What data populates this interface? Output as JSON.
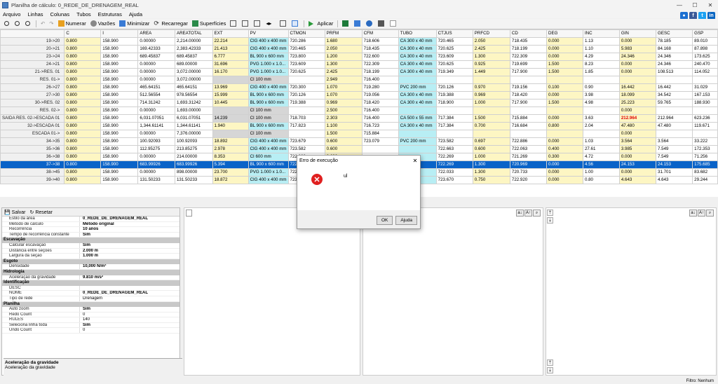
{
  "window": {
    "title": "Planilha de cálculo: 0_REDE_DE_DRENAGEM_REAL",
    "min": "—",
    "max": "☐",
    "close": "✕"
  },
  "menu": [
    "Arquivo",
    "Linhas",
    "Colunas",
    "Tubos",
    "Estruturas",
    "Ajuda"
  ],
  "toolbar": {
    "numerar": "Numerar",
    "vazoes": "Vazões",
    "minimizar": "Minimizar",
    "recarregar": "Recarregar",
    "superficies": "Superfícies",
    "aplicar": "Aplicar"
  },
  "columns": [
    "C",
    "I",
    "AREA",
    "AREATOTAL",
    "EXT",
    "PV",
    "CTMON",
    "PRFM",
    "CFM",
    "TUBO",
    "CTJUS",
    "PRFCD",
    "CD",
    "DEG",
    "INC",
    "GIN",
    "GESC",
    "GSP"
  ],
  "rows": [
    [
      "19->20",
      "0.800",
      "158.900",
      "0.00000",
      "2,214.00000",
      "22.214",
      "CIG 400 x 400 mm",
      "720.286",
      "1.680",
      "718.606",
      "CA 300 x 40 mm",
      "720.465",
      "2.050",
      "718.435",
      "0.000",
      "1.13",
      "0.000",
      "78.185",
      "89.010"
    ],
    [
      "20->21",
      "0.800",
      "158.900",
      "169.42333",
      "2,383.42333",
      "21.413",
      "CIG 400 x 400 mm",
      "720.465",
      "2.050",
      "718.435",
      "CA 300 x 40 mm",
      "720.625",
      "2.425",
      "718.199",
      "0.000",
      "1.10",
      "5.983",
      "84.168",
      "87.898"
    ],
    [
      "23->24",
      "0.800",
      "158.900",
      "689.45837",
      "689.45837",
      "6.777",
      "BL 900 x 600 mm",
      "723.800",
      "1.200",
      "722.600",
      "CA 300 x 40 mm",
      "723.609",
      "1.300",
      "722.309",
      "0.000",
      "4.29",
      "24.346",
      "24.346",
      "173.625"
    ],
    [
      "24->21",
      "0.800",
      "158.900",
      "0.00000",
      "689.00000",
      "31.696",
      "PVG 1.000 x 1.0...",
      "723.609",
      "1.300",
      "722.309",
      "CA 300 x 40 mm",
      "720.625",
      "0.925",
      "719.699",
      "1.500",
      "8.23",
      "0.000",
      "24.346",
      "240.470"
    ],
    [
      "21->RES. 01",
      "0.800",
      "158.900",
      "0.00000",
      "3,072.00000",
      "16.170",
      "PVG 1.000 x 1.0...",
      "720.625",
      "2.425",
      "718.199",
      "CA 300 x 40 mm",
      "719.349",
      "1.449",
      "717.900",
      "1.500",
      "1.85",
      "0.000",
      "108.513",
      "114.052"
    ],
    [
      "RES. 01->",
      "0.800",
      "158.900",
      "0.00000",
      "3,072.00000",
      "",
      "CI 100 mm",
      "",
      "2.949",
      "716.400",
      "",
      "",
      "",
      "",
      "",
      "",
      "",
      "",
      ""
    ],
    [
      "26->27",
      "0.800",
      "158.900",
      "465.64151",
      "465.64151",
      "13.969",
      "CIG 400 x 400 mm",
      "720.300",
      "1.070",
      "719.280",
      "PVC 200 mm",
      "720.126",
      "0.970",
      "719.156",
      "0.100",
      "0.90",
      "16.442",
      "16.442",
      "31.029"
    ],
    [
      "27->30",
      "0.800",
      "158.900",
      "512.56554",
      "978.56554",
      "15.999",
      "BL 900 x 600 mm",
      "720.126",
      "1.070",
      "719.056",
      "CA 300 x 40 mm",
      "719.388",
      "0.969",
      "718.420",
      "0.000",
      "3.98",
      "18.099",
      "34.542",
      "167.153"
    ],
    [
      "30->RES. 02",
      "0.800",
      "158.900",
      "714.31242",
      "1,693.31242",
      "10.445",
      "BL 900 x 600 mm",
      "719.388",
      "0.969",
      "718.420",
      "CA 300 x 40 mm",
      "718.900",
      "1.000",
      "717.900",
      "1.500",
      "4.98",
      "25.223",
      "59.765",
      "188.930"
    ],
    [
      "RES. 02->",
      "0.800",
      "158.900",
      "0.00000",
      "1,693.00000",
      "",
      "CI 100 mm",
      "",
      "2.500",
      "716.400",
      "",
      "",
      "",
      "",
      "",
      "",
      "0.000",
      "",
      ""
    ],
    [
      "SAIDA RES. 02->ESCADA 01",
      "0.800",
      "158.900",
      "6,031.07051",
      "6,031.07051",
      "14.239",
      "CI 100 mm",
      "718.703",
      "2.303",
      "716.400",
      "CA 500 x 55 mm",
      "717.384",
      "1.500",
      "715.884",
      "0.000",
      "3.63",
      "212.964",
      "212.964",
      "623.236"
    ],
    [
      "32->ESCADA 01",
      "0.800",
      "158.900",
      "1,344.61141",
      "1,344.61141",
      "1.940",
      "BL 900 x 600 mm",
      "717.823",
      "1.100",
      "716.723",
      "CA 300 x 40 mm",
      "717.384",
      "0.700",
      "716.684",
      "0.800",
      "2.04",
      "47.480",
      "47.480",
      "119.671"
    ],
    [
      "ESCADA 01->",
      "0.800",
      "158.900",
      "0.00000",
      "7,376.00000",
      "",
      "CI 100 mm",
      "",
      "1.500",
      "715.884",
      "",
      "",
      "",
      "",
      "",
      "",
      "0.000",
      "",
      ""
    ],
    [
      "34->35",
      "0.800",
      "158.900",
      "100.92093",
      "100.92093",
      "18.892",
      "CIG 400 x 400 mm",
      "723.679",
      "0.600",
      "723.079",
      "PVC 200 mm",
      "723.582",
      "0.697",
      "722.886",
      "0.000",
      "1.03",
      "3.564",
      "3.564",
      "33.222"
    ],
    [
      "35->36",
      "0.800",
      "158.900",
      "112.95275",
      "213.85275",
      "2.978",
      "CIG 400 x 400 mm",
      "723.582",
      "0.600",
      "",
      "",
      "722.663",
      "0.600",
      "722.063",
      "0.400",
      "27.61",
      "3.985",
      "7.549",
      "172.353"
    ],
    [
      "36->38",
      "0.800",
      "158.900",
      "0.00000",
      "214.00000",
      "8.353",
      "CI 600 mm",
      "722.663",
      "0.600",
      "",
      "",
      "722.269",
      "1.000",
      "721.269",
      "0.300",
      "4.72",
      "0.000",
      "7.549",
      "71.256"
    ],
    [
      "37->38",
      "0.800",
      "158.900",
      "683.99926",
      "683.99926",
      "5.394",
      "BL 900 x 600 mm",
      "722.415",
      "",
      "",
      "",
      "722.269",
      "1.300",
      "720.969",
      "0.000",
      "4.56",
      "24.153",
      "24.153",
      "175.685"
    ],
    [
      "38->45",
      "0.800",
      "158.900",
      "0.00000",
      "898.00000",
      "23.700",
      "PVG 1.000 x 1.0...",
      "722.269",
      "",
      "",
      "",
      "722.033",
      "1.300",
      "720.733",
      "0.000",
      "1.00",
      "0.000",
      "31.701",
      "83.682"
    ],
    [
      "39->40",
      "0.800",
      "158.900",
      "131.50233",
      "131.50233",
      "18.872",
      "CIG 400 x 400 mm",
      "723.670",
      "",
      "",
      "",
      "723.670",
      "0.750",
      "722.920",
      "0.000",
      "0.80",
      "4.643",
      "4.643",
      "29.244"
    ]
  ],
  "selected_row": 16,
  "props": {
    "salvar": "Salvar",
    "resetar": "Resetar",
    "items": [
      {
        "k": "Estilo da área",
        "v": "0_REDE_DE_DRENAGEM_REAL",
        "cat": false
      },
      {
        "k": "Método de cálculo",
        "v": "Método original",
        "cat": false
      },
      {
        "k": "Recorrência",
        "v": "10 anos",
        "cat": false
      },
      {
        "k": "Tempo de recorrência constante",
        "v": "Sim",
        "cat": false
      },
      {
        "k": "Escavação",
        "v": "",
        "cat": true
      },
      {
        "k": "Calcular escavação",
        "v": "Sim",
        "cat": false
      },
      {
        "k": "Distância entre seções",
        "v": "2.000 m",
        "cat": false
      },
      {
        "k": "Largura da seção",
        "v": "1.000 m",
        "cat": false
      },
      {
        "k": "Esgoto",
        "v": "",
        "cat": true
      },
      {
        "k": "Densidade",
        "v": "10,000 N/m³",
        "cat": false
      },
      {
        "k": "Hidrologia",
        "v": "",
        "cat": true
      },
      {
        "k": "Aceleração da gravidade",
        "v": "9.810 m/s²",
        "cat": false
      },
      {
        "k": "Identificação",
        "v": "",
        "cat": true
      },
      {
        "k": "DESC",
        "v": "",
        "cat": false
      },
      {
        "k": "NOME",
        "v": "0_REDE_DE_DRENAGEM_REAL",
        "cat": false
      },
      {
        "k": "Tipo de rede",
        "v": "Drenagem",
        "cat": false
      },
      {
        "k": "Planilha",
        "v": "",
        "cat": true
      },
      {
        "k": "Auto zoom",
        "v": "Sim",
        "cat": false
      },
      {
        "k": "Redo Count",
        "v": "0",
        "cat": false
      },
      {
        "k": "RULES",
        "v": "140",
        "cat": false
      },
      {
        "k": "Seleciona linha toda",
        "v": "Sim",
        "cat": false
      },
      {
        "k": "Undo Count",
        "v": "0",
        "cat": false
      }
    ],
    "desc_title": "Aceleração da gravidade",
    "desc_text": "Aceleração da gravidade"
  },
  "dialog": {
    "title": "Erro de execução",
    "message": "ul",
    "ok": "OK",
    "help": "Ajuda"
  },
  "status": "Filtro:  Nenhum"
}
